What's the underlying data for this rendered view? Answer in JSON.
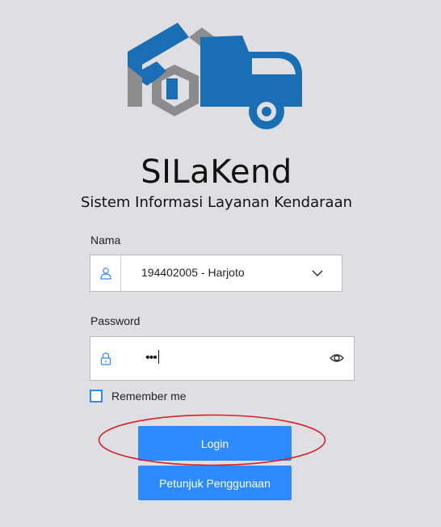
{
  "app": {
    "title": "SILaKend",
    "subtitle": "Sistem Informasi Layanan Kendaraan"
  },
  "form": {
    "nama_label": "Nama",
    "nama_value": "194402005 - Harjoto",
    "password_label": "Password",
    "password_value": "•••",
    "remember_label": "Remember me",
    "remember_checked": false
  },
  "buttons": {
    "login_label": "Login",
    "guide_label": "Petunjuk Penggunaan"
  },
  "colors": {
    "accent": "#2e8bff",
    "logo_blue": "#1a6fb4",
    "logo_gray": "#8c8c8e",
    "annotation_red": "#d81f2a",
    "background": "#dfdfe3"
  },
  "icons": {
    "nama_field": "user-icon",
    "password_field": "lock-icon",
    "password_toggle": "eye-icon",
    "select_arrow": "chevron-down-icon"
  }
}
